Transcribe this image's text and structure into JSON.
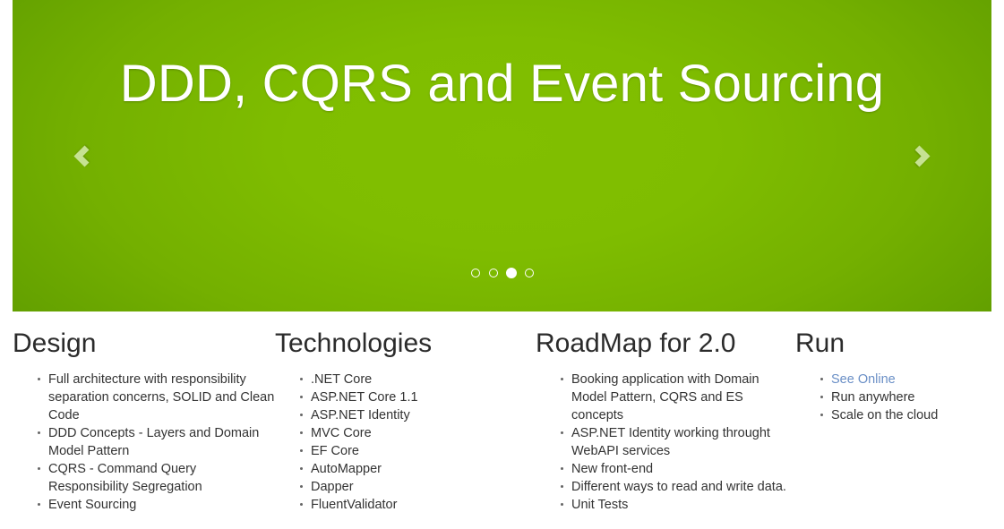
{
  "carousel": {
    "title": "DDD, CQRS and Event Sourcing",
    "prev_label": "‹",
    "next_label": "›",
    "indicators": [
      {
        "label": "1",
        "active": false
      },
      {
        "label": "2",
        "active": false
      },
      {
        "label": "3",
        "active": true
      },
      {
        "label": "4",
        "active": false
      }
    ],
    "background_color_center": "#81bf00",
    "background_color_edge": "#559000",
    "title_color": "#ffffff",
    "control_color": "#c6e292"
  },
  "features": [
    {
      "heading": "Design",
      "items": [
        {
          "text": "Full architecture with responsibility separation concerns, SOLID and Clean Code",
          "link": false
        },
        {
          "text": "DDD Concepts - Layers and Domain Model Pattern",
          "link": false
        },
        {
          "text": "CQRS - Command Query Responsibility Segregation",
          "link": false
        },
        {
          "text": "Event Sourcing",
          "link": false
        }
      ]
    },
    {
      "heading": "Technologies",
      "items": [
        {
          "text": ".NET Core",
          "link": false
        },
        {
          "text": "ASP.NET Core 1.1",
          "link": false
        },
        {
          "text": "ASP.NET Identity",
          "link": false
        },
        {
          "text": "MVC Core",
          "link": false
        },
        {
          "text": "EF Core",
          "link": false
        },
        {
          "text": "AutoMapper",
          "link": false
        },
        {
          "text": "Dapper",
          "link": false
        },
        {
          "text": "FluentValidator",
          "link": false
        }
      ]
    },
    {
      "heading": "RoadMap for 2.0",
      "items": [
        {
          "text": "Booking application with Domain Model Pattern, CQRS and ES concepts",
          "link": false
        },
        {
          "text": "ASP.NET Identity working throught WebAPI services",
          "link": false
        },
        {
          "text": "New front-end",
          "link": false
        },
        {
          "text": "Different ways to read and write data.",
          "link": false
        },
        {
          "text": "Unit Tests",
          "link": false
        }
      ]
    },
    {
      "heading": "Run",
      "items": [
        {
          "text": "See Online",
          "link": true
        },
        {
          "text": "Run anywhere",
          "link": false
        },
        {
          "text": "Scale on the cloud",
          "link": false
        }
      ]
    }
  ],
  "colors": {
    "link": "#6a8fc6",
    "text": "#333333",
    "heading": "#2b2b2b",
    "page_background": "#ffffff"
  }
}
